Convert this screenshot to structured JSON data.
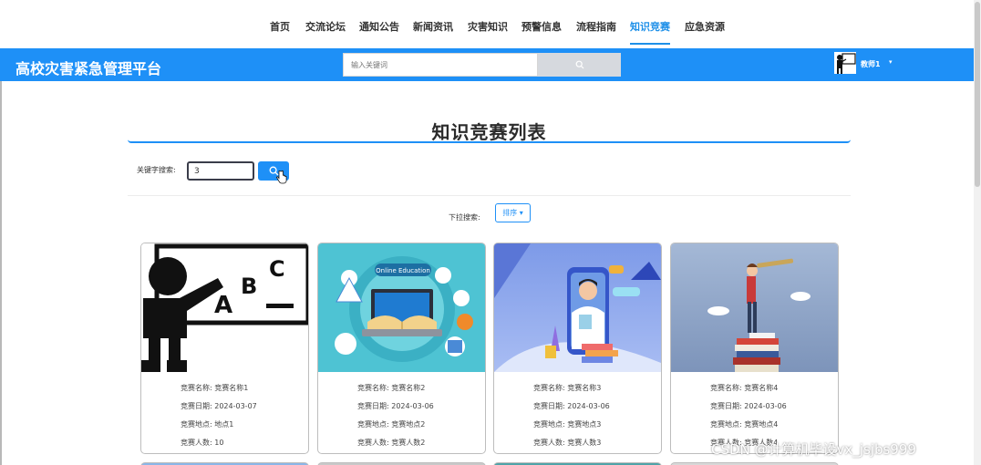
{
  "nav": {
    "items": [
      {
        "label": "首页"
      },
      {
        "label": "交流论坛"
      },
      {
        "label": "通知公告"
      },
      {
        "label": "新闻资讯"
      },
      {
        "label": "灾害知识"
      },
      {
        "label": "预警信息"
      },
      {
        "label": "流程指南"
      },
      {
        "label": "知识竞赛",
        "active": true
      },
      {
        "label": "应急资源"
      }
    ]
  },
  "header": {
    "site_title": "高校灾害紧急管理平台",
    "search_placeholder": "输入关键词",
    "search_icon": "search-icon",
    "user_name": "教师1",
    "user_caret": "▾"
  },
  "section": {
    "title": "知识竞赛列表",
    "keyword_label": "关键字搜索:",
    "keyword_value": "3",
    "sort_label": "下拉搜索:",
    "sort_button": "排序 ▾"
  },
  "cards": [
    {
      "image_icon": "teacher-blackboard-illustration",
      "name_label": "竞赛名称:",
      "name": "竞赛名称1",
      "date_label": "竞赛日期:",
      "date": "2024-03-07",
      "place_label": "竞赛地点:",
      "place": "地点1",
      "count_label": "竞赛人数:",
      "count": "10"
    },
    {
      "image_icon": "online-education-illustration",
      "name_label": "竞赛名称:",
      "name": "竞赛名称2",
      "date_label": "竞赛日期:",
      "date": "2024-03-06",
      "place_label": "竞赛地点:",
      "place": "竞赛地点2",
      "count_label": "竞赛人数:",
      "count": "竞赛人数2"
    },
    {
      "image_icon": "doctor-phone-illustration",
      "name_label": "竞赛名称:",
      "name": "竞赛名称3",
      "date_label": "竞赛日期:",
      "date": "2024-03-06",
      "place_label": "竞赛地点:",
      "place": "竞赛地点3",
      "count_label": "竞赛人数:",
      "count": "竞赛人数3"
    },
    {
      "image_icon": "telescope-books-illustration",
      "name_label": "竞赛名称:",
      "name": "竞赛名称4",
      "date_label": "竞赛日期:",
      "date": "2024-03-06",
      "place_label": "竞赛地点:",
      "place": "竞赛地点4",
      "count_label": "竞赛人数:",
      "count": "竞赛人数4"
    }
  ],
  "watermark": "CSDN @计算机毕设vx_jsjbs999",
  "colors": {
    "accent": "#1e90f7",
    "active_nav": "#1e90e8"
  }
}
